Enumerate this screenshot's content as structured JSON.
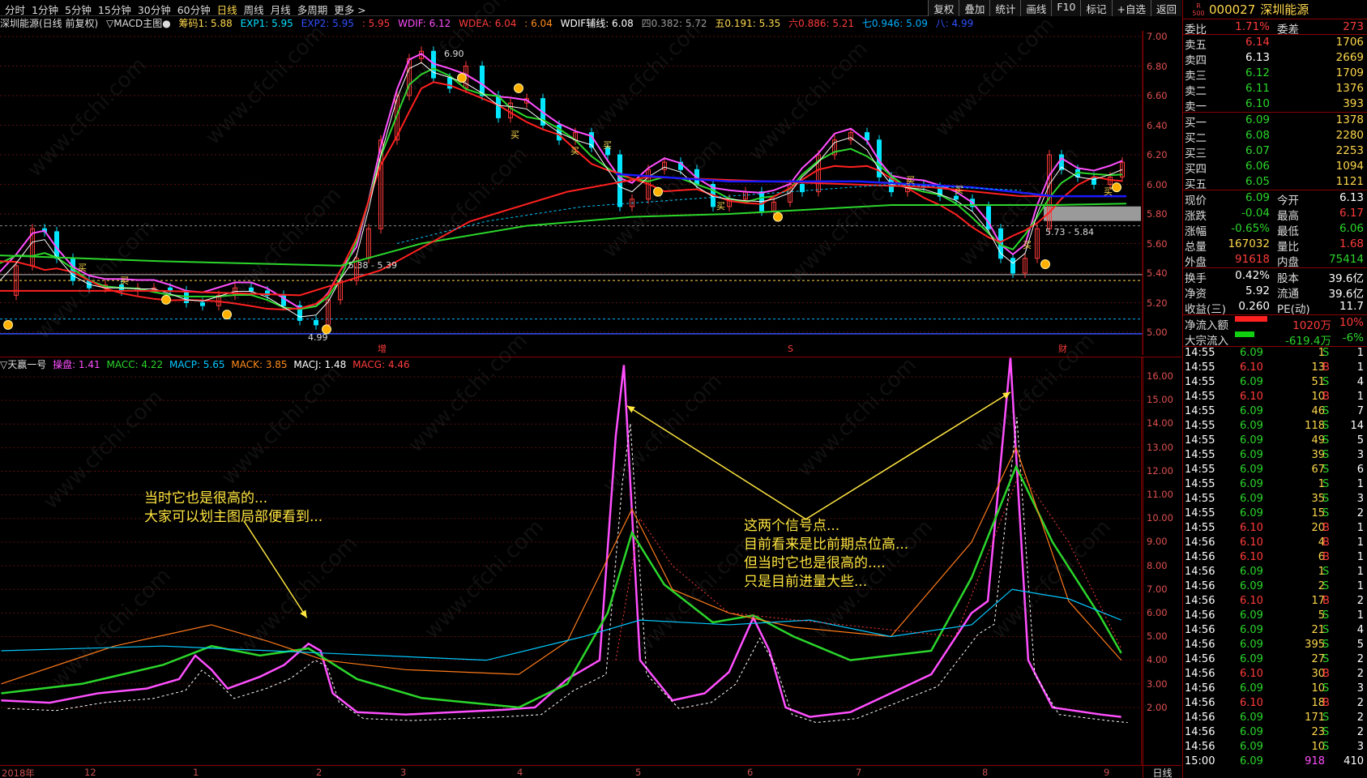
{
  "periods": [
    "分时",
    "1分钟",
    "5分钟",
    "15分钟",
    "30分钟",
    "60分钟",
    "日线",
    "周线",
    "月线",
    "多周期",
    "更多 >"
  ],
  "active_period": "日线",
  "tools": [
    "复权",
    "叠加",
    "统计",
    "画线",
    "F10",
    "标记",
    "+自选",
    "返回"
  ],
  "infoline": {
    "title": "深圳能源(日线 前复权)",
    "indicator": "▽MACD主图●",
    "choumaLabel": "筹码1: 5.88",
    "exp1": "EXP1: 5.95",
    "exp2": "EXP2: 5.95",
    "exp2b": ": 5.95",
    "wdif": "WDIF: 6.12",
    "wdea": "WDEA: 6.04",
    "wdea2": ": 6.04",
    "wdifaux": "WDIF辅线: 6.08",
    "si": "四0.382: 5.72",
    "wu": "五0.191: 5.35",
    "liu": "六0.886: 5.21",
    "qi": "七0.946: 5.09",
    "ba": "八: 4.99"
  },
  "main_yaxis": [
    "7.00",
    "6.80",
    "6.60",
    "6.40",
    "6.20",
    "6.00",
    "5.80",
    "5.60",
    "5.40",
    "5.20",
    "5.00"
  ],
  "main_labels": {
    "high": "6.90",
    "low": "4.99",
    "range1": "5.38 - 5.39",
    "range2": "5.73 - 5.84",
    "mark_zeng": "增",
    "mark_s": "S",
    "mark_cai": "财",
    "buy": "买"
  },
  "sub_title": {
    "name": "▽天赢一号",
    "control": "操盘: 1.41",
    "macc": "MACC: 4.22",
    "macp": "MACP: 5.65",
    "mack": "MACK: 3.85",
    "macj": "MACJ: 1.48",
    "macg": "MACG: 4.46"
  },
  "sub_yaxis": [
    "16.00",
    "15.00",
    "14.00",
    "13.00",
    "12.00",
    "11.00",
    "10.00",
    "9.00",
    "8.00",
    "7.00",
    "6.00",
    "5.00",
    "4.00",
    "3.00",
    "2.00"
  ],
  "x_labels": [
    "2018年",
    "12",
    "1",
    "2",
    "3",
    "4",
    "5",
    "6",
    "7",
    "8",
    "9"
  ],
  "daily_label": "日线",
  "notes": {
    "left": [
      "当时它也是很高的...",
      "大家可以划主图局部便看到..."
    ],
    "right": [
      "这两个信号点...",
      "目前看来是比前期点位高...",
      "但当时它也是很高的....",
      "只是目前进量大些..."
    ]
  },
  "watermark": "www.cfchi.com",
  "panel": {
    "r500": "R\n500",
    "code": "000027",
    "name": "深圳能源",
    "weibi_label": "委比",
    "weibi": "1.71%",
    "weicha_label": "委差",
    "weicha": "273",
    "asks": [
      {
        "label": "卖五",
        "price": "6.14",
        "vol": "1706"
      },
      {
        "label": "卖四",
        "price": "6.13",
        "vol": "2669"
      },
      {
        "label": "卖三",
        "price": "6.12",
        "vol": "1709"
      },
      {
        "label": "卖二",
        "price": "6.11",
        "vol": "1376"
      },
      {
        "label": "卖一",
        "price": "6.10",
        "vol": "393"
      }
    ],
    "bids": [
      {
        "label": "买一",
        "price": "6.09",
        "vol": "1378"
      },
      {
        "label": "买二",
        "price": "6.08",
        "vol": "2280"
      },
      {
        "label": "买三",
        "price": "6.07",
        "vol": "2253"
      },
      {
        "label": "买四",
        "price": "6.06",
        "vol": "1094"
      },
      {
        "label": "买五",
        "price": "6.05",
        "vol": "1121"
      }
    ],
    "stats": [
      {
        "l1": "现价",
        "v1": "6.09",
        "c1": "green",
        "l2": "今开",
        "v2": "6.13",
        "c2": "white"
      },
      {
        "l1": "涨跌",
        "v1": "-0.04",
        "c1": "green",
        "l2": "最高",
        "v2": "6.17",
        "c2": "red"
      },
      {
        "l1": "涨幅",
        "v1": "-0.65%",
        "c1": "green",
        "l2": "最低",
        "v2": "6.06",
        "c2": "green"
      },
      {
        "l1": "总量",
        "v1": "167032",
        "c1": "yellow",
        "l2": "量比",
        "v2": "1.68",
        "c2": "red"
      },
      {
        "l1": "外盘",
        "v1": "91618",
        "c1": "red",
        "l2": "内盘",
        "v2": "75414",
        "c2": "green"
      }
    ],
    "stats2": [
      {
        "l1": "换手",
        "v1": "0.42%",
        "c1": "white",
        "l2": "股本",
        "v2": "39.6亿",
        "c2": "white"
      },
      {
        "l1": "净资",
        "v1": "5.92",
        "c1": "white",
        "l2": "流通",
        "v2": "39.6亿",
        "c2": "white"
      },
      {
        "l1": "收益(三)",
        "v1": "0.260",
        "c1": "white",
        "l2": "PE(动)",
        "v2": "11.7",
        "c2": "white"
      }
    ],
    "flow": [
      {
        "label": "净流入额",
        "value": "1020万",
        "pct": "10%",
        "color": "red"
      },
      {
        "label": "大宗流入",
        "value": "-619.4万",
        "pct": "-6%",
        "color": "green"
      }
    ],
    "ticks": [
      [
        "14:55",
        "6.09",
        "1",
        "S",
        "1"
      ],
      [
        "14:55",
        "6.10",
        "13",
        "B",
        "1"
      ],
      [
        "14:55",
        "6.09",
        "51",
        "S",
        "4"
      ],
      [
        "14:55",
        "6.10",
        "10",
        "B",
        "1"
      ],
      [
        "14:55",
        "6.09",
        "46",
        "S",
        "7"
      ],
      [
        "14:55",
        "6.09",
        "118",
        "S",
        "14"
      ],
      [
        "14:55",
        "6.09",
        "49",
        "S",
        "5"
      ],
      [
        "14:55",
        "6.09",
        "39",
        "S",
        "3"
      ],
      [
        "14:55",
        "6.09",
        "67",
        "S",
        "6"
      ],
      [
        "14:55",
        "6.09",
        "1",
        "S",
        "1"
      ],
      [
        "14:55",
        "6.09",
        "35",
        "S",
        "3"
      ],
      [
        "14:55",
        "6.09",
        "15",
        "S",
        "2"
      ],
      [
        "14:55",
        "6.10",
        "20",
        "B",
        "1"
      ],
      [
        "14:56",
        "6.10",
        "4",
        "B",
        "1"
      ],
      [
        "14:56",
        "6.10",
        "6",
        "B",
        "1"
      ],
      [
        "14:56",
        "6.09",
        "1",
        "S",
        "1"
      ],
      [
        "14:56",
        "6.09",
        "2",
        "S",
        "1"
      ],
      [
        "14:56",
        "6.10",
        "17",
        "B",
        "2"
      ],
      [
        "14:56",
        "6.09",
        "5",
        "S",
        "1"
      ],
      [
        "14:56",
        "6.09",
        "21",
        "S",
        "4"
      ],
      [
        "14:56",
        "6.09",
        "395",
        "S",
        "5"
      ],
      [
        "14:56",
        "6.09",
        "27",
        "S",
        "2"
      ],
      [
        "14:56",
        "6.10",
        "30",
        "B",
        "2"
      ],
      [
        "14:56",
        "6.09",
        "10",
        "S",
        "3"
      ],
      [
        "14:56",
        "6.10",
        "18",
        "B",
        "2"
      ],
      [
        "14:56",
        "6.09",
        "171",
        "S",
        "2"
      ],
      [
        "14:56",
        "6.09",
        "23",
        "S",
        "2"
      ],
      [
        "14:56",
        "6.09",
        "10",
        "S",
        "3"
      ],
      [
        "15:00",
        "6.09",
        "918",
        "",
        "410"
      ]
    ]
  }
}
